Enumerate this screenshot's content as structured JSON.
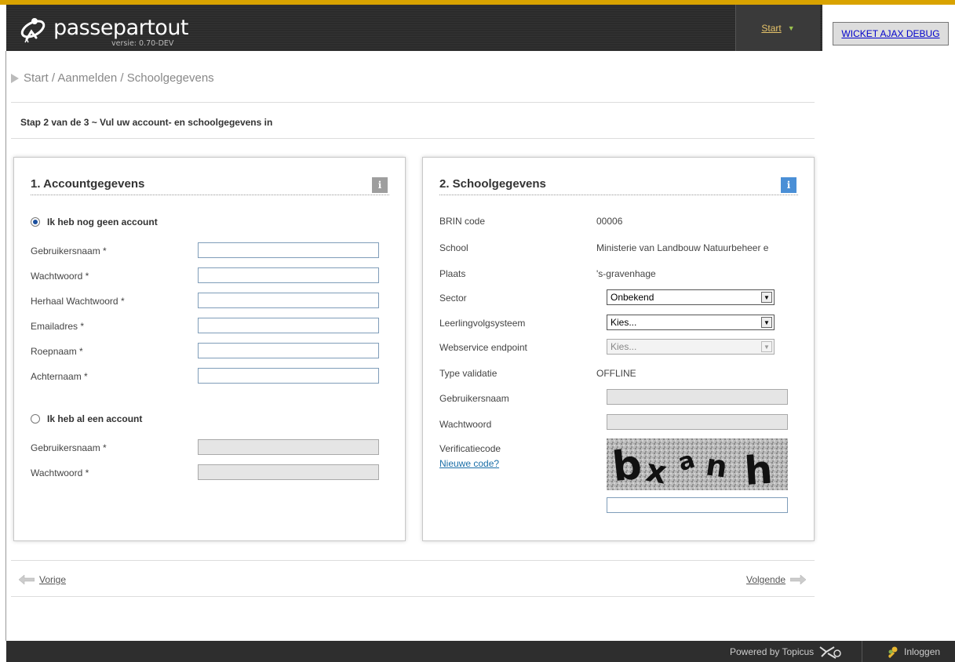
{
  "header": {
    "app_name": "passepartout",
    "version": "versie: 0.70-DEV",
    "start_menu_label": "Start",
    "debug_button_label": "WICKET AJAX DEBUG"
  },
  "breadcrumb": "Start / Aanmelden / Schoolgegevens",
  "step_title": "Stap 2 van de 3 ~ Vul uw account- en schoolgegevens in",
  "account_panel": {
    "title": "1. Accountgegevens",
    "no_account_option": "Ik heb nog geen account",
    "no_account_selected": true,
    "new_account_fields": [
      {
        "label": "Gebruikersnaam *",
        "value": ""
      },
      {
        "label": "Wachtwoord *",
        "value": ""
      },
      {
        "label": "Herhaal Wachtwoord *",
        "value": ""
      },
      {
        "label": "Emailadres *",
        "value": ""
      },
      {
        "label": "Roepnaam *",
        "value": ""
      },
      {
        "label": "Achternaam *",
        "value": ""
      }
    ],
    "has_account_option": "Ik heb al een account",
    "has_account_selected": false,
    "existing_account_fields": [
      {
        "label": "Gebruikersnaam *",
        "value": ""
      },
      {
        "label": "Wachtwoord *",
        "value": ""
      }
    ]
  },
  "school_panel": {
    "title": "2. Schoolgegevens",
    "brin_label": "BRIN code",
    "brin_value": "00006",
    "school_label": "School",
    "school_value": "Ministerie van Landbouw Natuurbeheer e",
    "place_label": "Plaats",
    "place_value": "'s-gravenhage",
    "sector_label": "Sector",
    "sector_value": "Onbekend",
    "lvs_label": "Leerlingvolgsysteem",
    "lvs_value": "Kies...",
    "endpoint_label": "Webservice endpoint",
    "endpoint_value": "Kies...",
    "validation_label": "Type validatie",
    "validation_value": "OFFLINE",
    "username_label": "Gebruikersnaam",
    "password_label": "Wachtwoord",
    "verification_label": "Verificatiecode",
    "new_code_link": "Nieuwe code?",
    "captcha_text": "bxành",
    "verification_value": ""
  },
  "navigation": {
    "prev_label": "Vorige",
    "next_label": "Volgende"
  },
  "footer": {
    "powered_by": "Powered by Topicus",
    "login_label": "Inloggen"
  },
  "colors": {
    "header_bg": "#2b2b2b",
    "accent_line": "#d9a300",
    "start_link": "#e6c36a",
    "info_icon_gray": "#9e9e9e",
    "info_icon_blue": "#4a8fd6",
    "link": "#1a6fa8"
  }
}
